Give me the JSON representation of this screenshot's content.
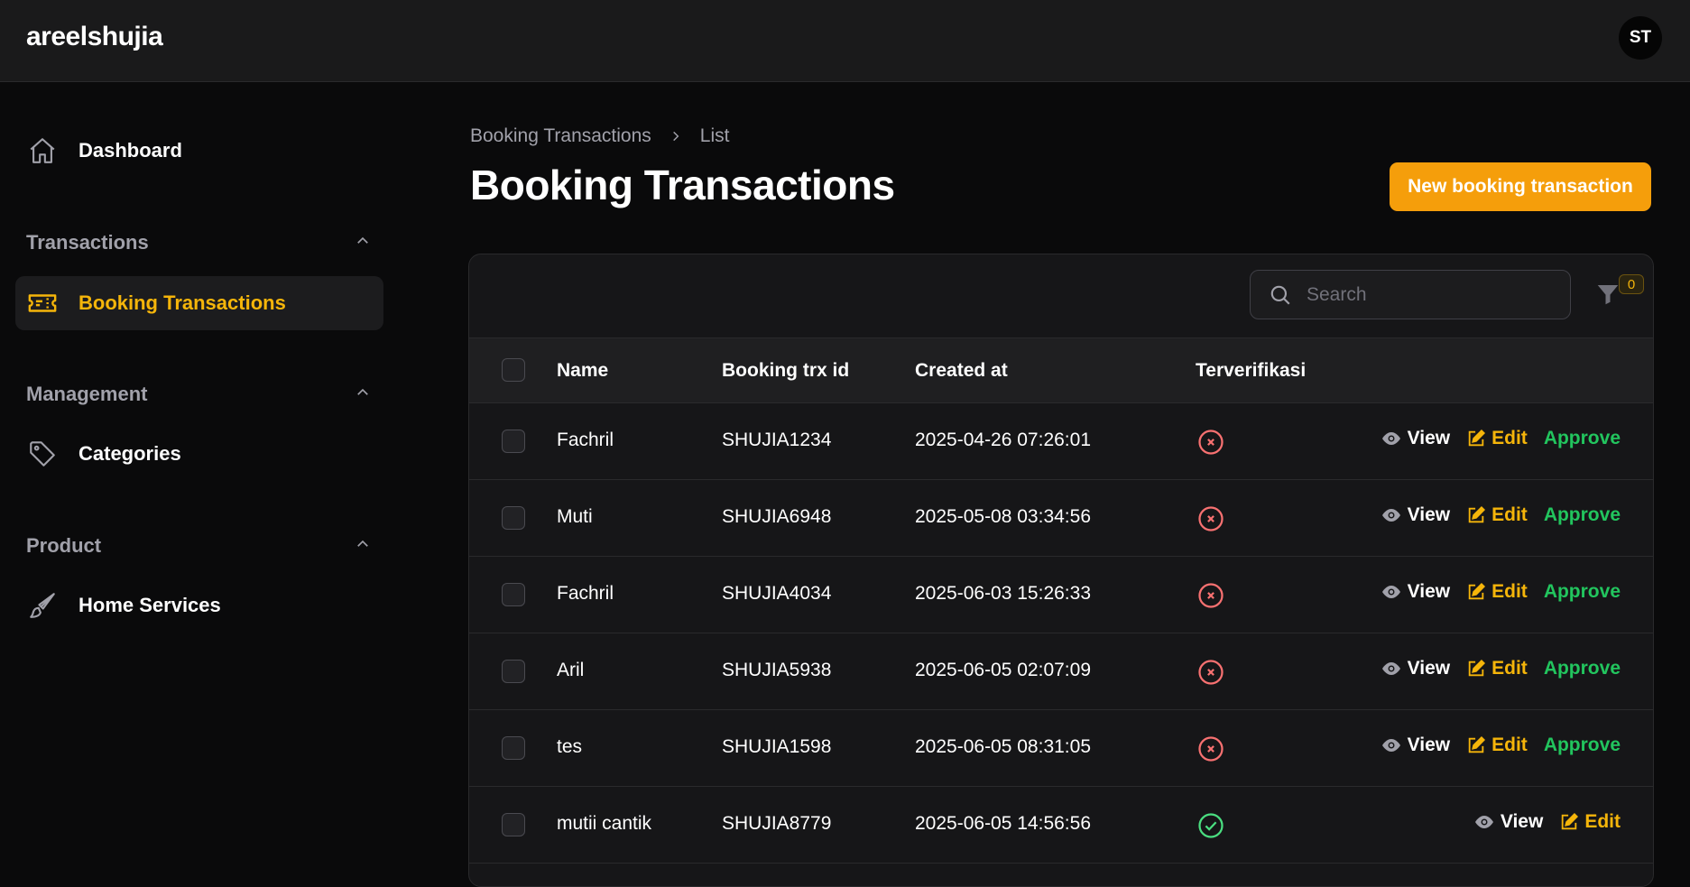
{
  "topbar": {
    "brand": "areelshujia",
    "avatar_initials": "ST"
  },
  "sidebar": {
    "dashboard": "Dashboard",
    "groups": [
      {
        "label": "Transactions",
        "items": [
          "Booking Transactions"
        ]
      },
      {
        "label": "Management",
        "items": [
          "Categories"
        ]
      },
      {
        "label": "Product",
        "items": [
          "Home Services"
        ]
      }
    ],
    "active_item": "Booking Transactions"
  },
  "breadcrumb": {
    "parent": "Booking Transactions",
    "current": "List"
  },
  "page": {
    "title": "Booking Transactions",
    "new_button": "New booking transaction"
  },
  "toolbar": {
    "search_placeholder": "Search",
    "filter_count": "0"
  },
  "table": {
    "columns": [
      "Name",
      "Booking trx id",
      "Created at",
      "Terverifikasi"
    ],
    "actions": {
      "view": "View",
      "edit": "Edit",
      "approve": "Approve"
    },
    "rows": [
      {
        "name": "Fachril",
        "trx_id": "SHUJIA1234",
        "created_at": "2025-04-26 07:26:01",
        "verified": false
      },
      {
        "name": "Muti",
        "trx_id": "SHUJIA6948",
        "created_at": "2025-05-08 03:34:56",
        "verified": false
      },
      {
        "name": "Fachril",
        "trx_id": "SHUJIA4034",
        "created_at": "2025-06-03 15:26:33",
        "verified": false
      },
      {
        "name": "Aril",
        "trx_id": "SHUJIA5938",
        "created_at": "2025-06-05 02:07:09",
        "verified": false
      },
      {
        "name": "tes",
        "trx_id": "SHUJIA1598",
        "created_at": "2025-06-05 08:31:05",
        "verified": false
      },
      {
        "name": "mutii cantik",
        "trx_id": "SHUJIA8779",
        "created_at": "2025-06-05 14:56:56",
        "verified": true
      }
    ]
  },
  "colors": {
    "accent": "#f59e0b",
    "active_text": "#f5b50a",
    "approve": "#22c55e",
    "unverified": "#f87171",
    "verified": "#4ade80"
  }
}
